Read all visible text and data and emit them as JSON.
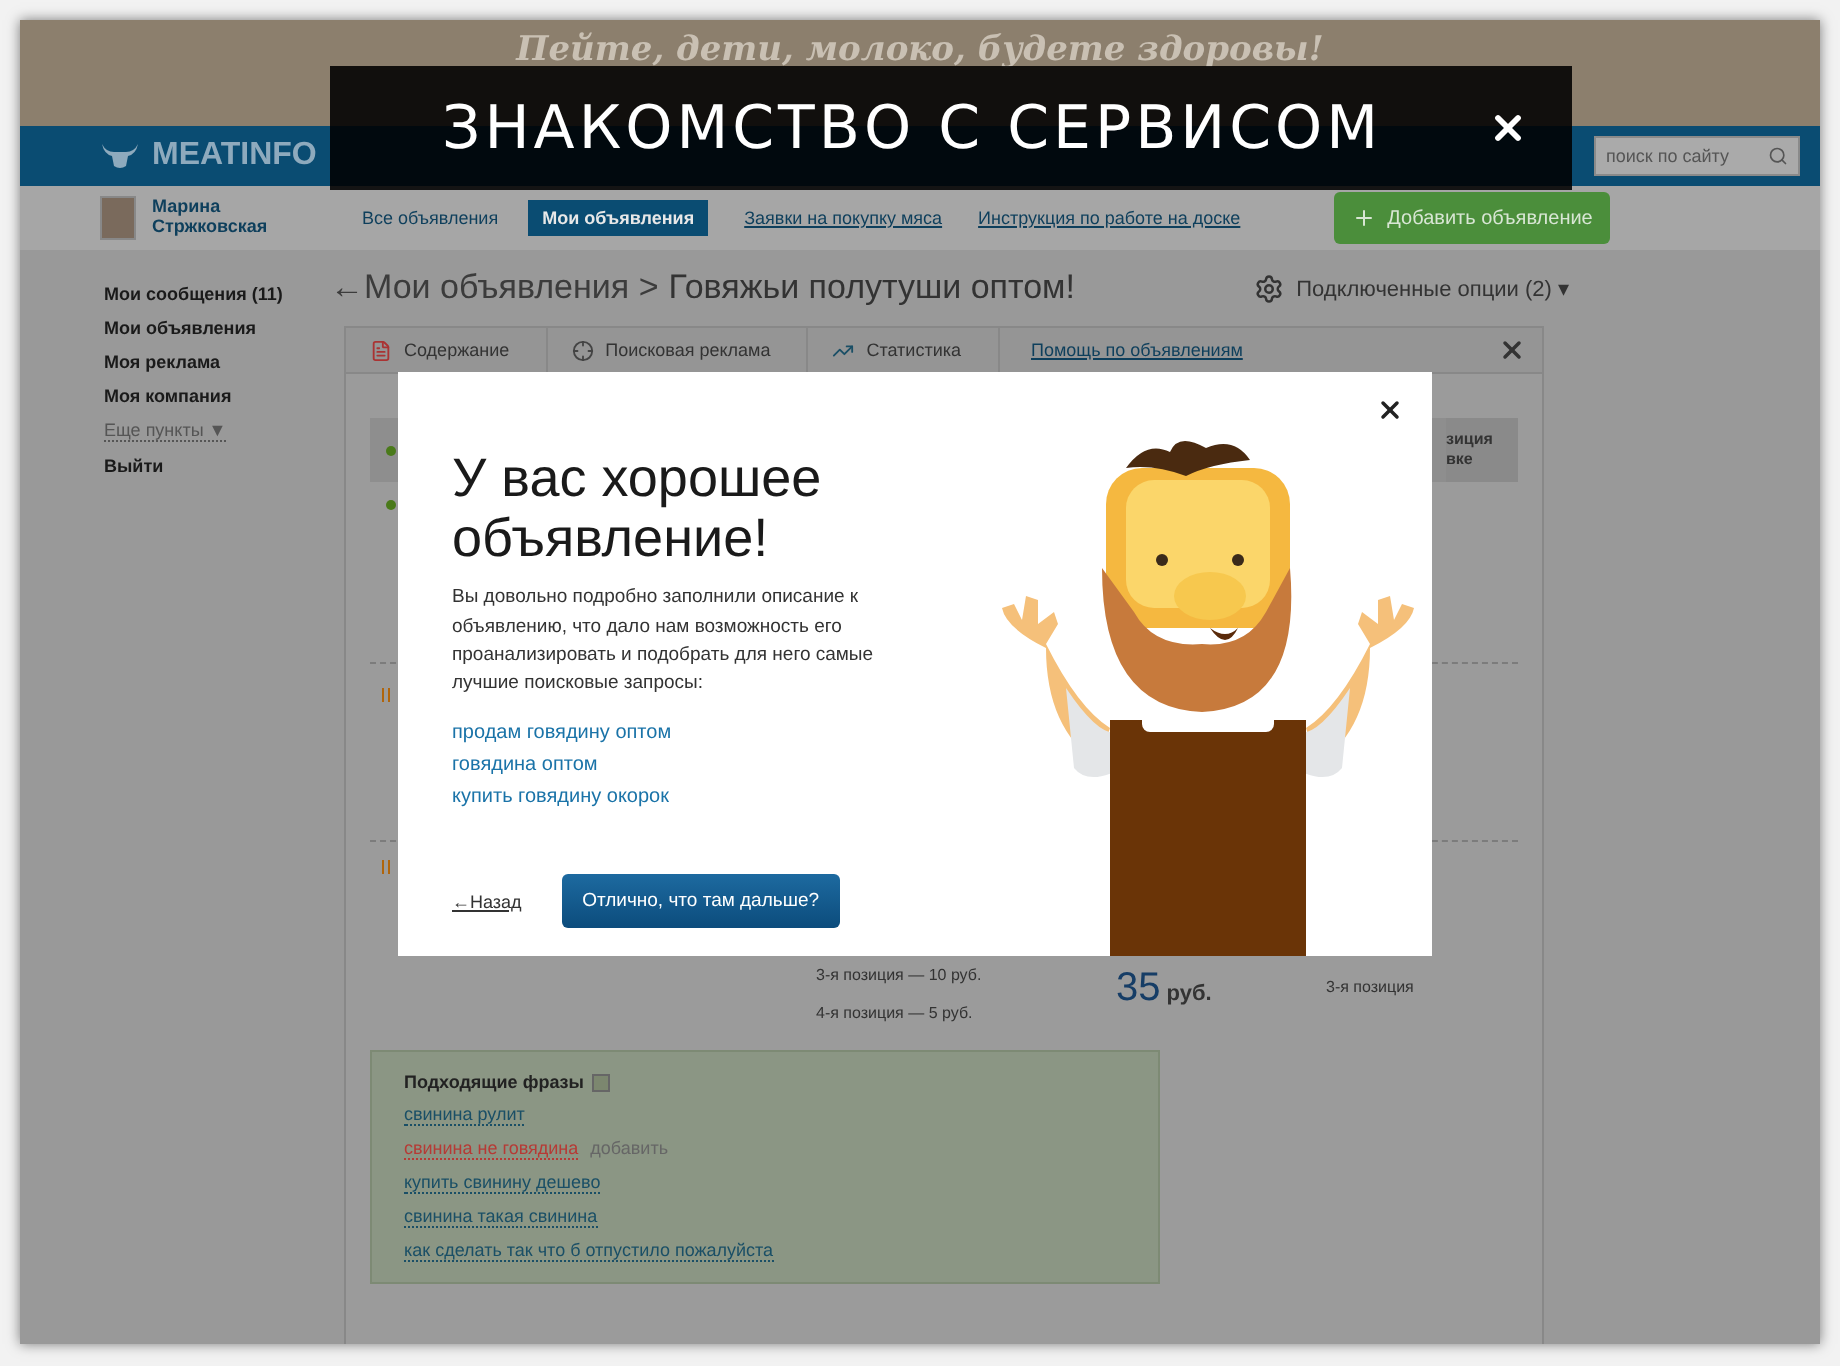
{
  "header": {
    "slogan": "Пейте, дети, молоко, будете здоровы!"
  },
  "logo": {
    "text": "MEATINFO"
  },
  "search": {
    "placeholder": "поиск по сайту"
  },
  "user": {
    "name": "Марина Стржковская"
  },
  "subnav": {
    "tabs": [
      {
        "label": "Все объявления",
        "selected": false
      },
      {
        "label": "Мои объявления",
        "selected": true
      }
    ],
    "links": [
      "Заявки на покупку мяса",
      "Инструкция по работе на доске"
    ],
    "add_button": "Добавить объявление"
  },
  "sidebar": {
    "items": [
      {
        "label": "Мои сообщения (11)",
        "kind": "link"
      },
      {
        "label": "Мои объявления",
        "kind": "link"
      },
      {
        "label": "Моя реклама",
        "kind": "link"
      },
      {
        "label": "Моя компания",
        "kind": "link"
      },
      {
        "label": "Еще пункты ▼",
        "kind": "more"
      },
      {
        "label": "Выйти",
        "kind": "link"
      }
    ]
  },
  "breadcrumb": {
    "back": "←",
    "parent": "Мои объявления",
    "separator": ">",
    "current": "Говяжьи полутуши оптом!"
  },
  "options": {
    "label": "Подключенные опции (2)",
    "caret": "▾"
  },
  "panel": {
    "tabs": [
      {
        "label": "Содержание",
        "kind": "content",
        "selected": false
      },
      {
        "label": "Поисковая реклама",
        "kind": "ads",
        "selected": false
      },
      {
        "label": "Статистика",
        "kind": "stats",
        "selected": false
      }
    ],
    "help_link": "Помощь по объявлениям",
    "position_header": [
      "зиция",
      "вке"
    ],
    "prices": [
      "3-я позиция — 10 руб.",
      "4-я позиция — 5 руб."
    ],
    "bid": {
      "amount": "35",
      "unit": "руб."
    },
    "position_label": "3-я позиция"
  },
  "phrases": {
    "title": "Подходящие фразы",
    "items": [
      {
        "text": "свинина рулит",
        "flagged": false
      },
      {
        "text": "свинина не говядина",
        "flagged": true,
        "action": "добавить"
      },
      {
        "text": "купить свинину дешево",
        "flagged": false
      },
      {
        "text": "свинина такая свинина",
        "flagged": false
      },
      {
        "text": "как сделать так что б отпустило пожалуйста",
        "flagged": false
      }
    ]
  },
  "modal": {
    "title": "У вас хорошее объявление!",
    "text": "Вы довольно подробно заполнили описание к объявлению, что  дало нам возможность его проанализировать и подобрать для него самые лучшие поисковые запросы:",
    "queries": [
      "продам говядину оптом",
      "говядина оптом",
      "купить говядину окорок"
    ],
    "back": "←Назад",
    "button": "Отлично, что там дальше?"
  },
  "tour_banner": {
    "title": "ЗНАКОМСТВО С СЕРВИСОМ"
  }
}
